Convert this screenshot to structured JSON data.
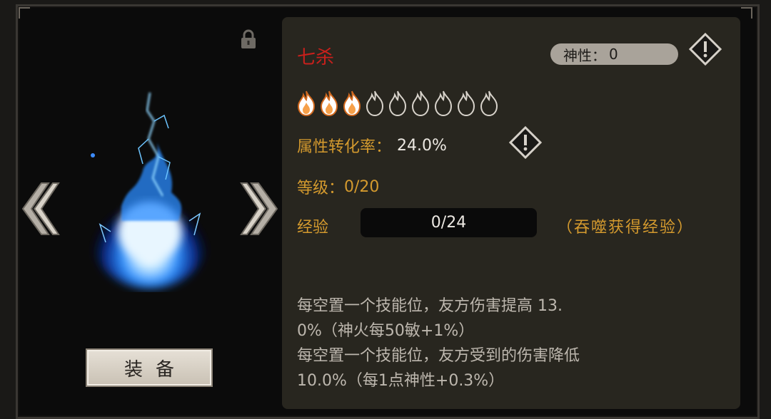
{
  "item": {
    "name": "七杀",
    "divinity_label": "神性：",
    "divinity_value": "0",
    "locked": true,
    "flames_total": 9,
    "flames_filled": 3,
    "rate_label": "属性转化率：",
    "rate_value": "24.0%",
    "level_label": "等级：",
    "level_value": "0/20",
    "exp_label": "经验",
    "exp_value": "0/24",
    "exp_progress": 0,
    "exp_hint": "（吞噬获得经验）",
    "description": [
      "每空置一个技能位，友方伤害提高 13.",
      "0%（神火每50敏+1%）",
      "每空置一个技能位，友方受到的伤害降低",
      "10.0%（每1点神性+0.3%）"
    ]
  },
  "actions": {
    "equip_label": "装备"
  },
  "colors": {
    "name": "#c8201c",
    "label_gold": "#d49a2e",
    "flame_blue": "#2a8cff",
    "panel_bg": "#28261f"
  },
  "icons": {
    "lock": "lock-icon",
    "prev": "chevron-left-icon",
    "next": "chevron-right-icon",
    "info": "warning-diamond-icon",
    "flame": "flame-icon"
  }
}
